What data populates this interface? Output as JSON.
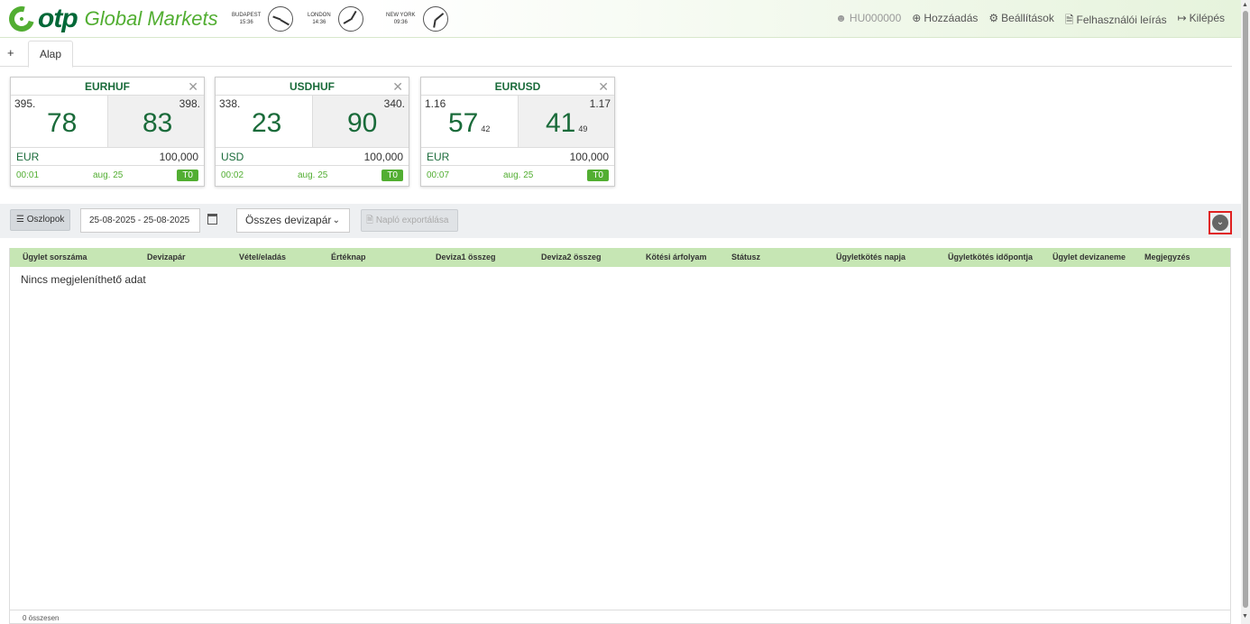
{
  "header": {
    "logo_text": "otp",
    "logo_subtitle": "Global Markets",
    "clocks": [
      {
        "city": "BUDAPEST",
        "time": "15:36"
      },
      {
        "city": "LONDON",
        "time": "14:36"
      },
      {
        "city": "NEW YORK",
        "time": "09:36"
      }
    ],
    "user_id": "HU000000",
    "add_label": "Hozzáadás",
    "settings_label": "Beállítások",
    "manual_label": "Felhasználói leírás",
    "logout_label": "Kilépés"
  },
  "tabs": {
    "add_symbol": "+",
    "items": [
      {
        "label": "Alap"
      }
    ]
  },
  "tiles": [
    {
      "pair": "EURHUF",
      "bid_prefix": "395.",
      "bid_big": "78",
      "bid_sup": "",
      "ask_prefix": "398.",
      "ask_big": "83",
      "ask_sup": "",
      "currency": "EUR",
      "amount": "100,000",
      "time": "00:01",
      "date": "aug. 25",
      "tenor": "T0"
    },
    {
      "pair": "USDHUF",
      "bid_prefix": "338.",
      "bid_big": "23",
      "bid_sup": "",
      "ask_prefix": "340.",
      "ask_big": "90",
      "ask_sup": "",
      "currency": "USD",
      "amount": "100,000",
      "time": "00:02",
      "date": "aug. 25",
      "tenor": "T0"
    },
    {
      "pair": "EURUSD",
      "bid_prefix": "1.16",
      "bid_big": "57",
      "bid_sup": "42",
      "ask_prefix": "1.17",
      "ask_big": "41",
      "ask_sup": "49",
      "currency": "EUR",
      "amount": "100,000",
      "time": "00:07",
      "date": "aug. 25",
      "tenor": "T0"
    }
  ],
  "toolbar": {
    "columns_label": "Oszlopok",
    "date_range": "25-08-2025 - 25-08-2025",
    "pair_filter": "Összes devizapár",
    "export_label": "Napló exportálása"
  },
  "table": {
    "columns": [
      "Ügylet sorszáma",
      "Devizapár",
      "Vétel/eladás",
      "Értéknap",
      "Deviza1 összeg",
      "Deviza2 összeg",
      "Kötési árfolyam",
      "Státusz",
      "Ügyletkötés napja",
      "Ügyletkötés időpontja",
      "Ügylet devizaneme",
      "Megjegyzés"
    ],
    "empty_message": "Nincs megjeleníthető adat",
    "total_label": "0 összesen"
  },
  "colors": {
    "brand_green": "#52ae32",
    "dark_green": "#1a6b3a",
    "header_row": "#c6e6b4",
    "highlight_border": "#e02020"
  }
}
